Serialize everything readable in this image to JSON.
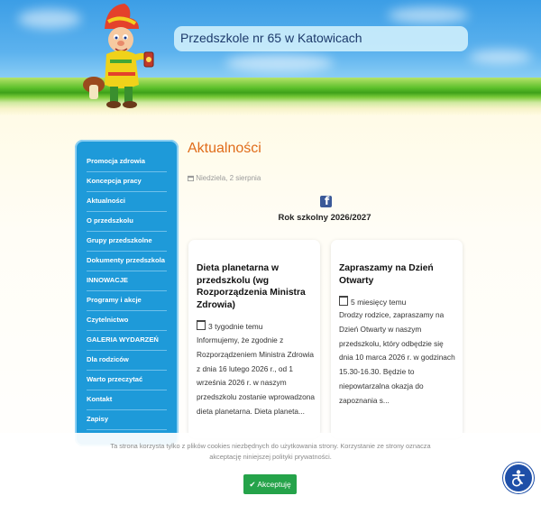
{
  "header": {
    "site_title": "Przedszkole nr 65 w Katowicach"
  },
  "sidebar": {
    "items": [
      {
        "label": "Promocja zdrowia"
      },
      {
        "label": "Koncepcja pracy"
      },
      {
        "label": "Aktualności"
      },
      {
        "label": "O przedszkolu"
      },
      {
        "label": "Grupy przedszkolne"
      },
      {
        "label": "Dokumenty przedszkola"
      },
      {
        "label": "INNOWACJE"
      },
      {
        "label": "Programy i akcje"
      },
      {
        "label": "Czytelnictwo"
      },
      {
        "label": "GALERIA WYDARZEŃ"
      },
      {
        "label": "Dla rodziców"
      },
      {
        "label": "Warto przeczytać"
      },
      {
        "label": "Kontakt"
      },
      {
        "label": "Zapisy"
      }
    ]
  },
  "main": {
    "section_title": "Aktualności",
    "date": "Niedziela, 2 sierpnia",
    "year_title": "Rok szkolny 2026/2027",
    "cards": [
      {
        "title": "Dieta planetarna w przedszkolu (wg Rozporządzenia Ministra Zdrowia)",
        "meta": "3 tygodnie temu",
        "text": "Informujemy, że zgodnie z Rozporządzeniem Ministra Zdrowia z dnia 16 lutego 2026 r., od 1 września 2026 r. w naszym przedszkolu zostanie wprowadzona dieta planetarna. Dieta planeta..."
      },
      {
        "title": "Zapraszamy na Dzień Otwarty",
        "meta": "5 miesięcy temu",
        "text": "Drodzy rodzice, zapraszamy na Dzień Otwarty w naszym przedszkolu, który odbędzie się dnia 10 marca 2026 r. w godzinach 15.30-16.30. Będzie to niepowtarzalna okazja do zapoznania s..."
      }
    ]
  },
  "cookie": {
    "text": "Ta strona korzysta tylko z plików cookies niezbędnych do użytkowania strony. Korzystanie ze strony oznacza akceptację niniejszej polityki prywatności.",
    "accept_label": "Akceptuję"
  },
  "colors": {
    "sidebar": "#1e9ad9",
    "accent": "#e06c1a",
    "accept": "#25a34a",
    "accessibility": "#1e4fa8"
  },
  "icons": [
    "calendar-icon",
    "facebook-icon",
    "check-icon",
    "accessibility-icon"
  ]
}
